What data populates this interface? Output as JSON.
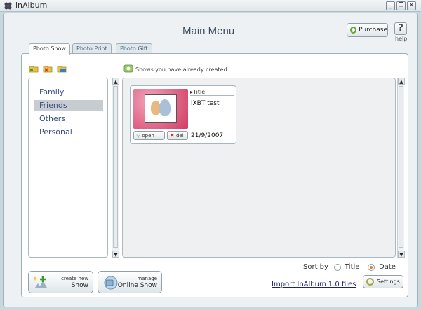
{
  "window": {
    "title": "inAlbum",
    "minimize": "_",
    "restore": "❐",
    "close": "✕"
  },
  "header": {
    "title": "Main Menu",
    "purchase_label": "Purchase",
    "help_icon": "?",
    "help_label": "help"
  },
  "tabs": [
    {
      "label": "Photo Show"
    },
    {
      "label": "Photo Print"
    },
    {
      "label": "Photo Gift"
    }
  ],
  "toolbar": {
    "icons": [
      "add-category-icon",
      "remove-category-icon",
      "rename-category-icon"
    ]
  },
  "categories": [
    {
      "label": "Family",
      "selected": false
    },
    {
      "label": "Friends",
      "selected": true
    },
    {
      "label": "Others",
      "selected": false
    },
    {
      "label": "Personal",
      "selected": false
    }
  ],
  "shows": {
    "label": "Shows you have already created",
    "items": [
      {
        "title_header": "▸Title",
        "name": "iXBT test",
        "date": "21/9/2007",
        "open_label": "open",
        "del_label": "del"
      }
    ]
  },
  "actions": {
    "create_top": "create new",
    "create_bottom": "Show",
    "manage_top": "manage",
    "manage_bottom": "Online Show"
  },
  "sort": {
    "label": "Sort by",
    "options": [
      {
        "label": "Title",
        "checked": false
      },
      {
        "label": "Date",
        "checked": true
      }
    ]
  },
  "import_link": "Import InAlbum 1.0 files",
  "settings_label": "Settings",
  "colors": {
    "accent": "#3b4f86",
    "selection": "#c7ccd1",
    "thumb_bg": "#d23a63",
    "radio_on": "#e07d2a"
  }
}
